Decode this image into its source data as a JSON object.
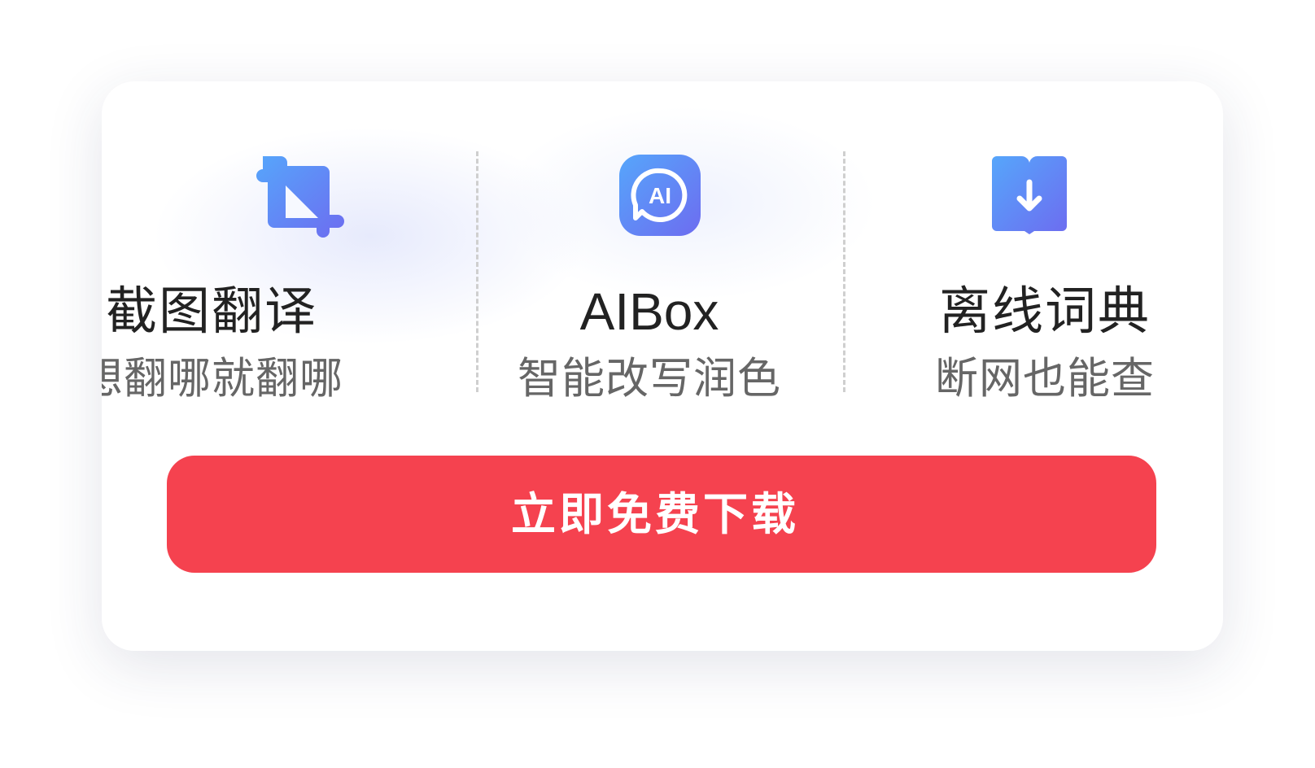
{
  "features": [
    {
      "icon": "crop-icon",
      "title": "截图翻译",
      "subtitle": "想翻哪就翻哪"
    },
    {
      "icon": "ai-chat-icon",
      "title": "AIBox",
      "subtitle": "智能改写润色",
      "icon_text": "AI"
    },
    {
      "icon": "book-download-icon",
      "title": "离线词典",
      "subtitle": "断网也能查"
    }
  ],
  "cta": {
    "label": "立即免费下载"
  },
  "colors": {
    "accent_blue": "#5b8ff9",
    "accent_purple": "#6d6cf0",
    "cta_red": "#f5424f",
    "title_text": "#222222",
    "subtitle_text": "#666666"
  }
}
